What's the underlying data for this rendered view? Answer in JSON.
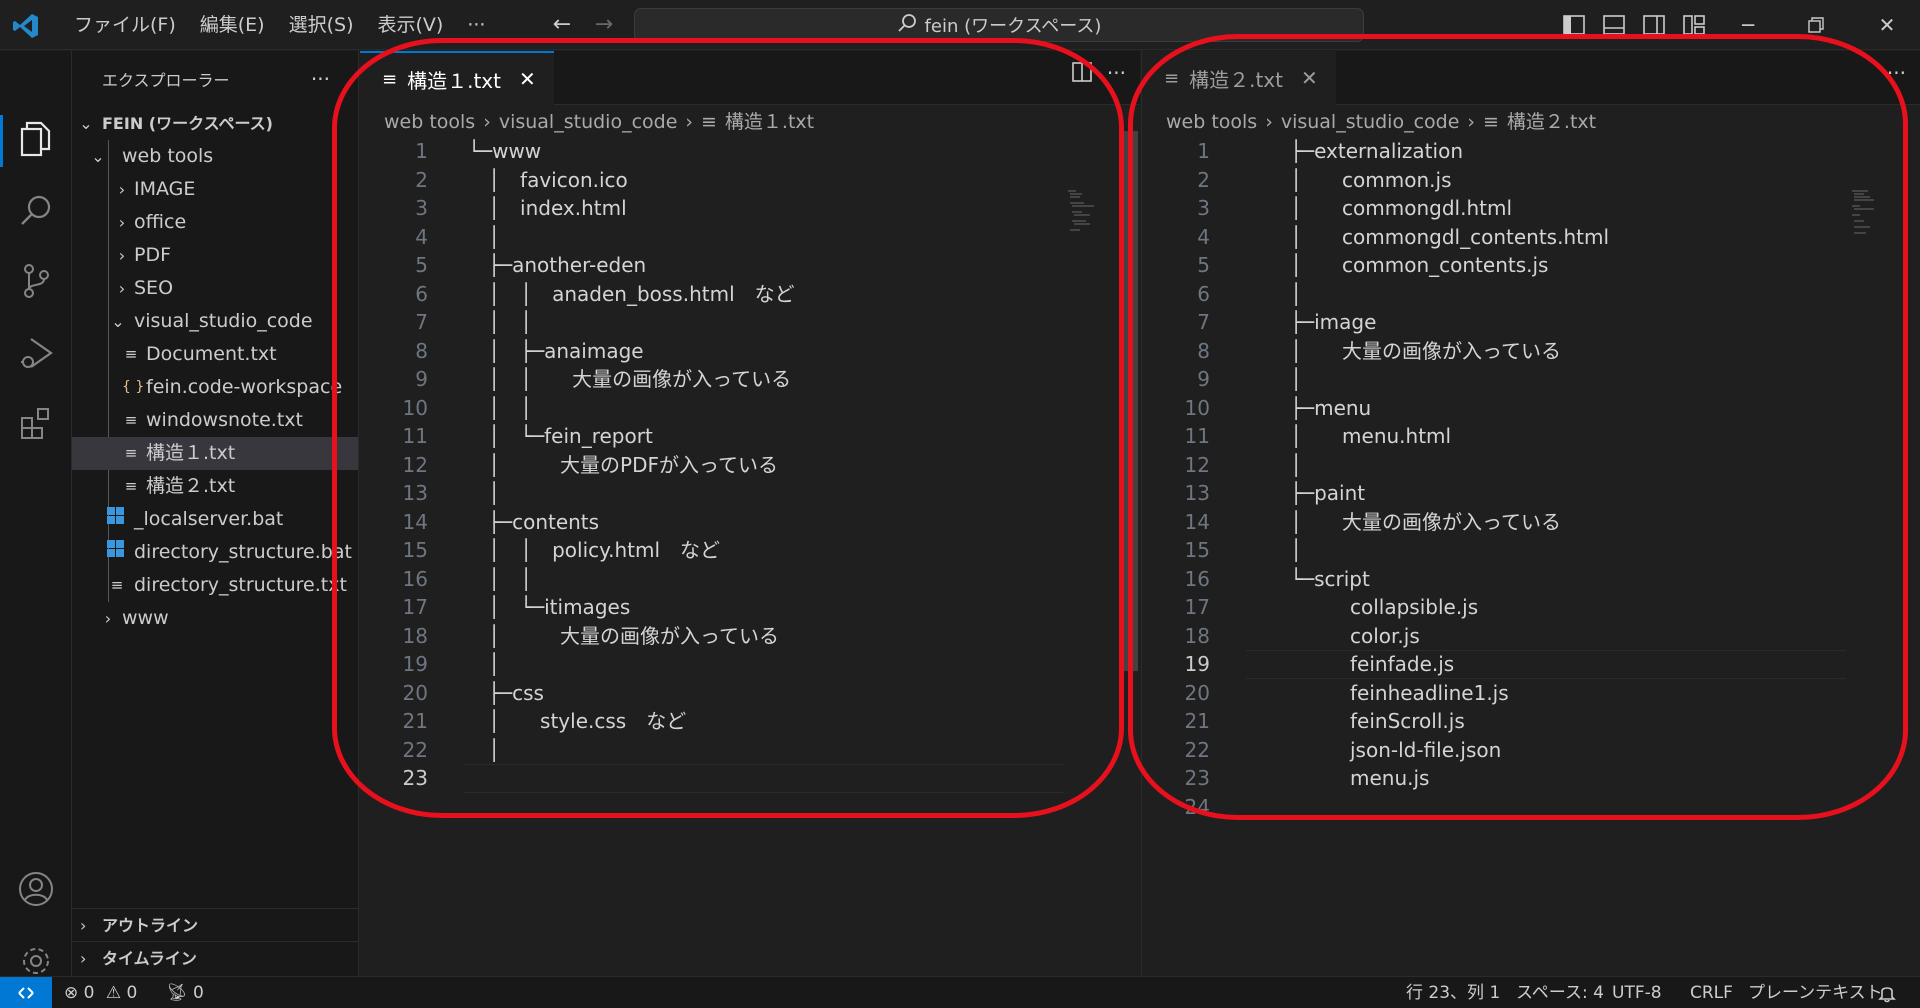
{
  "titlebar": {
    "menus": [
      "ファイル(F)",
      "編集(E)",
      "選択(S)",
      "表示(V)",
      "···"
    ],
    "search_text": "fein (ワークスペース)"
  },
  "sidebar": {
    "title": "エクスプローラー",
    "more": "···",
    "workspace": "FEIN (ワークスペース)",
    "tree": [
      {
        "label": "web tools",
        "kind": "folder-open"
      },
      {
        "label": "IMAGE",
        "kind": "folder"
      },
      {
        "label": "office",
        "kind": "folder"
      },
      {
        "label": "PDF",
        "kind": "folder"
      },
      {
        "label": "SEO",
        "kind": "folder"
      },
      {
        "label": "visual_studio_code",
        "kind": "folder-open"
      },
      {
        "label": "Document.txt",
        "kind": "text-file"
      },
      {
        "label": "fein.code-workspace",
        "kind": "json-file"
      },
      {
        "label": "windowsnote.txt",
        "kind": "text-file"
      },
      {
        "label": "構造１.txt",
        "kind": "text-file",
        "selected": true
      },
      {
        "label": "構造２.txt",
        "kind": "text-file"
      },
      {
        "label": "_localserver.bat",
        "kind": "bat-file"
      },
      {
        "label": "directory_structure.bat",
        "kind": "bat-file"
      },
      {
        "label": "directory_structure.txt",
        "kind": "text-file"
      },
      {
        "label": "www",
        "kind": "folder"
      }
    ],
    "outline": "アウトライン",
    "timeline": "タイムライン"
  },
  "editor_left": {
    "tab_label": "構造１.txt",
    "close": "✕",
    "breadcrumb": [
      "web tools",
      "visual_studio_code",
      "構造１.txt"
    ],
    "lines": [
      "　└─www",
      "　　│　favicon.ico",
      "　　│　index.html",
      "　　│",
      "　　├─another-eden",
      "　　│　│　anaden_boss.html　など",
      "　　│　│",
      "　　│　├─anaimage",
      "　　│　│　　大量の画像が入っている",
      "　　│　│",
      "　　│　└─fein_report",
      "　　│　　　大量のPDFが入っている",
      "　　│",
      "　　├─contents",
      "　　│　│　policy.html　など",
      "　　│　│",
      "　　│　└─itimages",
      "　　│　　　大量の画像が入っている",
      "　　│",
      "　　├─css",
      "　　│　　style.css　など",
      "　　│",
      ""
    ],
    "active_line": 23
  },
  "editor_right": {
    "tab_label": "構造２.txt",
    "close": "✕",
    "breadcrumb": [
      "web tools",
      "visual_studio_code",
      "構造２.txt"
    ],
    "lines": [
      "　　　├─externalization",
      "　　　│　　common.js",
      "　　　│　　commongdl.html",
      "　　　│　　commongdl_contents.html",
      "　　　│　　common_contents.js",
      "　　　│",
      "　　　├─image",
      "　　　│　　大量の画像が入っている",
      "　　　│",
      "　　　├─menu",
      "　　　│　　menu.html",
      "　　　│",
      "　　　├─paint",
      "　　　│　　大量の画像が入っている",
      "　　　│",
      "　　　└─script",
      "　　　　　　collapsible.js",
      "　　　　　　color.js",
      "　　　　　　feinfade.js",
      "　　　　　　feinheadline1.js",
      "　　　　　　feinScroll.js",
      "　　　　　　json-ld-file.json",
      "　　　　　　menu.js",
      ""
    ],
    "active_line": 19
  },
  "statusbar": {
    "remote_icon": "remote-icon",
    "errors": "0",
    "warnings": "0",
    "ports": "0",
    "position": "行 23、列 1",
    "spaces": "スペース: 4",
    "encoding": "UTF-8",
    "eol": "CRLF",
    "language": "プレーンテキスト"
  },
  "colors": {
    "accent": "#0078d4",
    "annotation": "#e8101c",
    "background": "#1f1f1f",
    "sidebar": "#181818"
  }
}
